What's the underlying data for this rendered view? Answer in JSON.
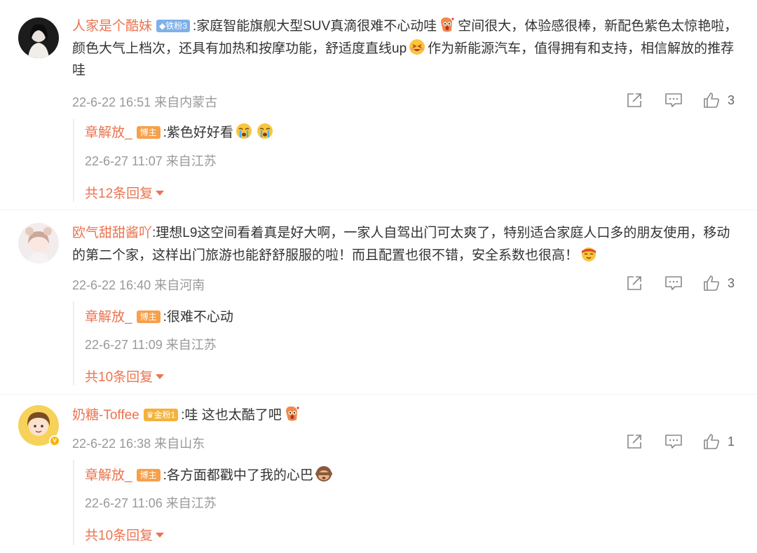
{
  "comments": [
    {
      "username": "人家是个酷妹",
      "badge": "铁粉3",
      "text_a": ":家庭智能旗舰大型SUV真滴很难不心动哇",
      "text_b": "空间很大，体验感很棒，新配色紫色太惊艳啦，颜色大气上档次，还具有加热和按摩功能，舒适度直线up",
      "text_c": "作为新能源汽车，值得拥有和支持，相信解放的推荐哇",
      "meta": "22-6-22 16:51 来自内蒙古",
      "likes": "3",
      "reply": {
        "username": "章解放_",
        "badge": "博主",
        "text": ":紫色好好看",
        "meta": "22-6-27 11:07 来自江苏",
        "more": "共12条回复"
      }
    },
    {
      "username": "欧气甜甜酱吖",
      "text_a": ":理想L9这空间看着真是好大啊，一家人自驾出门可太爽了，特别适合家庭人口多的朋友使用，移动的第二个家，这样出门旅游也能舒舒服服的啦！而且配置也很不错，安全系数也很高！",
      "meta": "22-6-22 16:40 来自河南",
      "likes": "3",
      "reply": {
        "username": "章解放_",
        "badge": "博主",
        "text": ":很难不心动",
        "meta": "22-6-27 11:09 来自江苏",
        "more": "共10条回复"
      }
    },
    {
      "username": "奶糖-Toffee",
      "badge": "金粉1",
      "text_a": ":哇 这也太酷了吧",
      "meta": "22-6-22 16:38 来自山东",
      "likes": "1",
      "reply": {
        "username": "章解放_",
        "badge": "博主",
        "text": ":各方面都戳中了我的心巴",
        "meta": "22-6-27 11:06 来自江苏",
        "more": "共10条回复"
      }
    }
  ],
  "colors": {
    "username": "#eb7350",
    "meta": "#999999",
    "fan_badge": "#7fb0e8",
    "gold_badge": "#f4b23c",
    "host_badge": "#f7a04b"
  },
  "icons": [
    "share-icon",
    "comment-icon",
    "thumbs-up-icon",
    "caret-down-icon",
    "emoji-icon"
  ]
}
